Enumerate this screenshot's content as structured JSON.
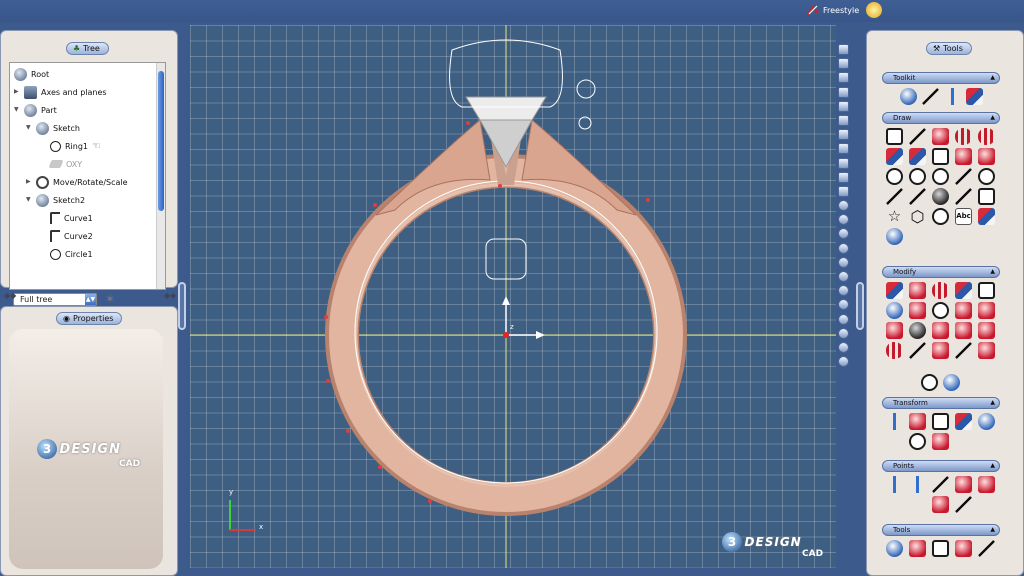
{
  "app": {
    "mode_label": "Freestyle"
  },
  "tree_panel": {
    "title": "Tree",
    "items": [
      {
        "label": "Root",
        "level": 0
      },
      {
        "label": "Axes and planes",
        "level": 1
      },
      {
        "label": "Part",
        "level": 1
      },
      {
        "label": "Sketch",
        "level": 2
      },
      {
        "label": "Ring1",
        "level": 3
      },
      {
        "label": "OXY",
        "level": 3
      },
      {
        "label": "Move/Rotate/Scale",
        "level": 2
      },
      {
        "label": "Sketch2",
        "level": 2
      },
      {
        "label": "Curve1",
        "level": 3
      },
      {
        "label": "Curve2",
        "level": 3
      },
      {
        "label": "Circle1",
        "level": 3
      }
    ],
    "filter_value": "Full tree"
  },
  "properties_panel": {
    "title": "Properties"
  },
  "logo": {
    "badge": "3",
    "word": "DESIGN",
    "sub": "CAD"
  },
  "tools_panel": {
    "title": "Tools",
    "sections": [
      {
        "label": "Toolkit"
      },
      {
        "label": "Draw"
      },
      {
        "label": "Modify"
      },
      {
        "label": "Transform"
      },
      {
        "label": "Points"
      },
      {
        "label": "Tools"
      }
    ],
    "text_tool_label": "Abc"
  },
  "viewport": {
    "axis_y": "y",
    "axis_x": "x",
    "axis_z": "z"
  },
  "colors": {
    "background": "#3c5a8c",
    "grid": "#3e5e82",
    "ring": "#d8a890",
    "accent": "#2f63c4"
  }
}
